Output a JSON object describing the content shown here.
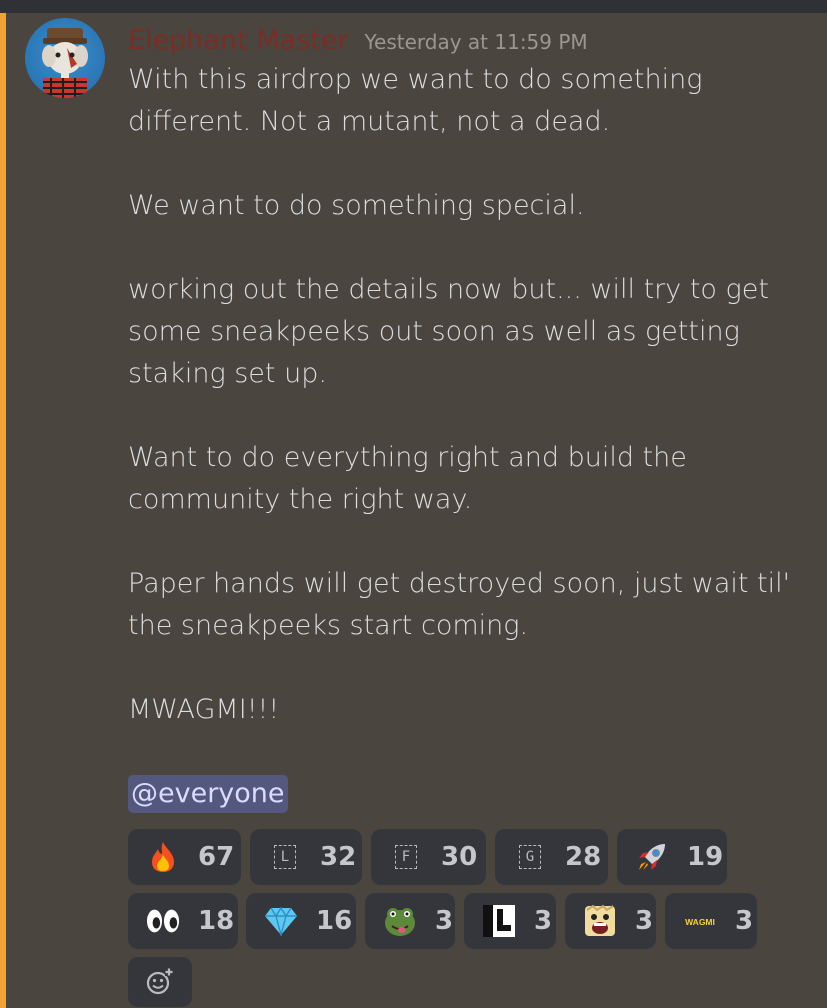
{
  "message": {
    "username": "Elephant Master",
    "timestamp": "Yesterday at 11:59 PM",
    "lines": [
      "With this airdrop we want to do something",
      "different. Not a mutant, not a dead.",
      "",
      "We want to do something special.",
      "",
      "working out the details now but... will try to get",
      "some sneakpeeks out soon as well as getting",
      "staking set up.",
      "",
      "Want to do everything right and build the",
      "community the right way.",
      "",
      "Paper hands will get destroyed soon, just wait til'",
      "the sneakpeeks start coming.",
      "",
      "MWAGMI!!!",
      ""
    ],
    "mention": "@everyone"
  },
  "reactions": [
    {
      "icon": "fire-icon",
      "count": "67"
    },
    {
      "icon": "letter-L-icon",
      "letter": "L",
      "count": "32"
    },
    {
      "icon": "letter-F-icon",
      "letter": "F",
      "count": "30"
    },
    {
      "icon": "letter-G-icon",
      "letter": "G",
      "count": "28"
    },
    {
      "icon": "rocket-icon",
      "count": "19"
    },
    {
      "icon": "eyes-icon",
      "count": "18"
    },
    {
      "icon": "gem-icon",
      "count": "16"
    },
    {
      "icon": "pepe-frog-icon",
      "count": "3"
    },
    {
      "icon": "pixel-L-icon",
      "count": "3"
    },
    {
      "icon": "screaming-face-icon",
      "count": "3"
    },
    {
      "icon": "wagmi-icon",
      "text": "WAGMI",
      "count": "3"
    }
  ],
  "colors": {
    "accent_bar": "#f0a232",
    "background": "#4a453f",
    "username": "#7a2c26",
    "mention_bg": "#54587f",
    "reaction_bg": "#35363b"
  }
}
